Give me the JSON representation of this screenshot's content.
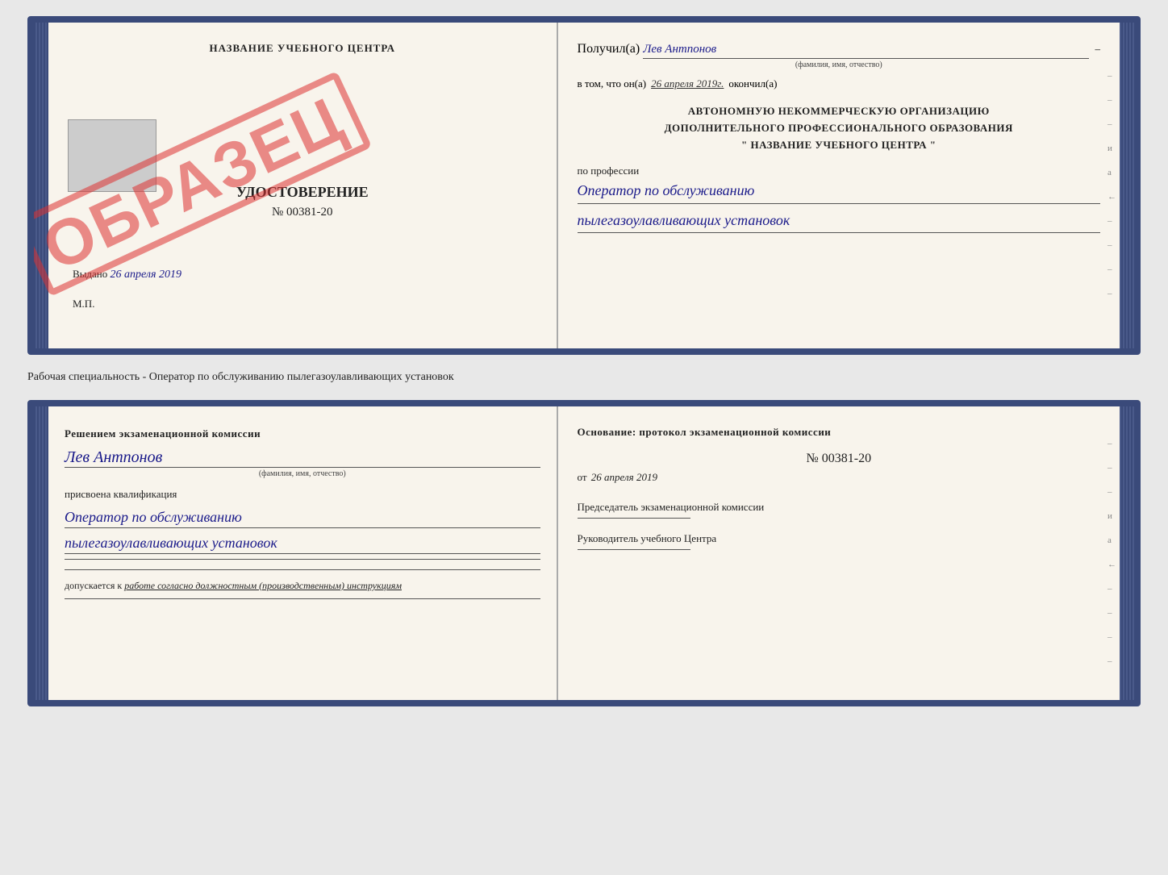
{
  "top_cert": {
    "left": {
      "title": "НАЗВАНИЕ УЧЕБНОГО ЦЕНТРА",
      "stamp": "ОБРАЗЕЦ",
      "cert_type": "УДОСТОВЕРЕНИЕ",
      "cert_number": "№ 00381-20",
      "issued_label": "Выдано",
      "issued_date": "26 апреля 2019",
      "mp": "М.П."
    },
    "right": {
      "received_label": "Получил(а)",
      "received_name": "Лев Антпонов",
      "received_sub": "(фамилия, имя, отчество)",
      "in_that_label": "в том, что он(а)",
      "in_that_date": "26 апреля 2019г.",
      "finished_label": "окончил(а)",
      "org_line1": "АВТОНОМНУЮ НЕКОММЕРЧЕСКУЮ ОРГАНИЗАЦИЮ",
      "org_line2": "ДОПОЛНИТЕЛЬНОГО ПРОФЕССИОНАЛЬНОГО ОБРАЗОВАНИЯ",
      "org_line3": "\"  НАЗВАНИЕ УЧЕБНОГО ЦЕНТРА  \"",
      "profession_label": "по профессии",
      "profession_line1": "Оператор по обслуживанию",
      "profession_line2": "пылегазоулавливающих установок"
    }
  },
  "separator": {
    "text": "Рабочая специальность - Оператор по обслуживанию пылегазоулавливающих установок"
  },
  "bottom_cert": {
    "left": {
      "title": "Решением экзаменационной комиссии",
      "name": "Лев Антпонов",
      "name_sub": "(фамилия, имя, отчество)",
      "assigned_label": "присвоена квалификация",
      "qual_line1": "Оператор по обслуживанию",
      "qual_line2": "пылегазоулавливающих установок",
      "admit_label": "допускается к",
      "admit_value": "работе согласно должностным (производственным) инструкциям"
    },
    "right": {
      "basis_label": "Основание: протокол экзаменационной комиссии",
      "number": "№ 00381-20",
      "date_prefix": "от",
      "date": "26 апреля 2019",
      "chairman_label": "Председатель экзаменационной комиссии",
      "director_label": "Руководитель учебного Центра"
    }
  },
  "side_marks": {
    "marks": [
      "-",
      "-",
      "-",
      "и",
      "а",
      "←",
      "-",
      "-",
      "-",
      "-"
    ]
  }
}
